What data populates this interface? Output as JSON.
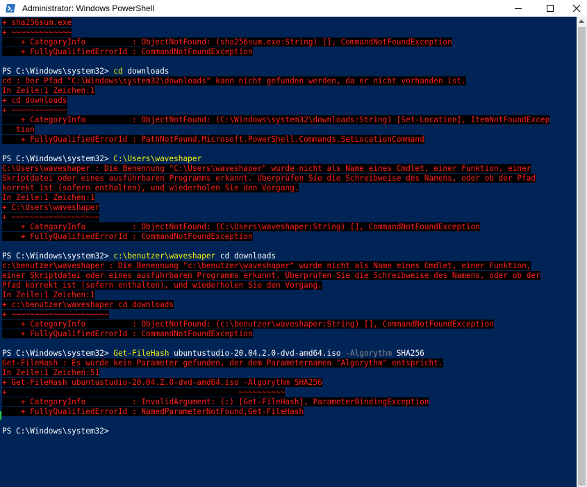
{
  "window": {
    "title": "Administrator: Windows PowerShell",
    "icon": "powershell-icon",
    "controls": {
      "minimize_icon": "minimize-icon",
      "maximize_icon": "maximize-icon",
      "close_icon": "close-icon"
    }
  },
  "colors": {
    "background": "#012456",
    "error_text": "#ff2020",
    "error_bg": "#000000",
    "command": "#f5f50a",
    "parameter": "#8a8a8a",
    "prompt": "#ffffff"
  },
  "console": {
    "lines": [
      [
        {
          "t": "err",
          "v": "+ sha256sum.exe"
        }
      ],
      [
        {
          "t": "err",
          "v": "+ ~~~~~~~~~~~~~"
        }
      ],
      [
        {
          "t": "err",
          "v": "    + CategoryInfo          : ObjectNotFound: (sha256sum.exe:String) [], CommandNotFoundException"
        }
      ],
      [
        {
          "t": "err",
          "v": "    + FullyQualifiedErrorId : CommandNotFoundException"
        }
      ],
      [],
      [
        {
          "t": "prompt",
          "v": "PS C:\\Windows\\system32> "
        },
        {
          "t": "cmd",
          "v": "cd"
        },
        {
          "t": "arg",
          "v": " downloads"
        }
      ],
      [
        {
          "t": "err",
          "v": "cd : Der Pfad \"C:\\Windows\\system32\\downloads\" kann nicht gefunden werden, da er nicht vorhanden ist."
        }
      ],
      [
        {
          "t": "err",
          "v": "In Zeile:1 Zeichen:1"
        }
      ],
      [
        {
          "t": "err",
          "v": "+ cd downloads"
        }
      ],
      [
        {
          "t": "err",
          "v": "+ ~~~~~~~~~~~~"
        }
      ],
      [
        {
          "t": "err",
          "v": "    + CategoryInfo          : ObjectNotFound: (C:\\Windows\\system32\\downloads:String) [Set-Location], ItemNotFoundExcep"
        }
      ],
      [
        {
          "t": "err",
          "v": "   tion"
        }
      ],
      [
        {
          "t": "err",
          "v": "    + FullyQualifiedErrorId : PathNotFound,Microsoft.PowerShell.Commands.SetLocationCommand"
        }
      ],
      [],
      [
        {
          "t": "prompt",
          "v": "PS C:\\Windows\\system32> "
        },
        {
          "t": "cmd",
          "v": "C:\\Users\\waveshaper"
        }
      ],
      [
        {
          "t": "err",
          "v": "C:\\Users\\waveshaper : Die Benennung \"C:\\Users\\waveshaper\" wurde nicht als Name eines Cmdlet, einer Funktion, einer"
        }
      ],
      [
        {
          "t": "err",
          "v": "Skriptdatei oder eines ausführbaren Programms erkannt. Überprüfen Sie die Schreibweise des Namens, oder ob der Pfad"
        }
      ],
      [
        {
          "t": "err",
          "v": "korrekt ist (sofern enthalten), und wiederholen Sie den Vorgang."
        }
      ],
      [
        {
          "t": "err",
          "v": "In Zeile:1 Zeichen:1"
        }
      ],
      [
        {
          "t": "err",
          "v": "+ C:\\Users\\waveshaper"
        }
      ],
      [
        {
          "t": "err",
          "v": "+ ~~~~~~~~~~~~~~~~~~~"
        }
      ],
      [
        {
          "t": "err",
          "v": "    + CategoryInfo          : ObjectNotFound: (C:\\Users\\waveshaper:String) [], CommandNotFoundException"
        }
      ],
      [
        {
          "t": "err",
          "v": "    + FullyQualifiedErrorId : CommandNotFoundException"
        }
      ],
      [],
      [
        {
          "t": "prompt",
          "v": "PS C:\\Windows\\system32> "
        },
        {
          "t": "cmd",
          "v": "c:\\benutzer\\waveshaper"
        },
        {
          "t": "arg",
          "v": " cd downloads"
        }
      ],
      [
        {
          "t": "err",
          "v": "c:\\benutzer\\waveshaper : Die Benennung \"c:\\benutzer\\waveshaper\" wurde nicht als Name eines Cmdlet, einer Funktion,"
        }
      ],
      [
        {
          "t": "err",
          "v": "einer Skriptdatei oder eines ausführbaren Programms erkannt. Überprüfen Sie die Schreibweise des Namens, oder ob der"
        }
      ],
      [
        {
          "t": "err",
          "v": "Pfad korrekt ist (sofern enthalten), und wiederholen Sie den Vorgang."
        }
      ],
      [
        {
          "t": "err",
          "v": "In Zeile:1 Zeichen:1"
        }
      ],
      [
        {
          "t": "err",
          "v": "+ c:\\benutzer\\waveshaper cd downloads"
        }
      ],
      [
        {
          "t": "err",
          "v": "+ ~~~~~~~~~~~~~~~~~~~~~"
        }
      ],
      [
        {
          "t": "err",
          "v": "    + CategoryInfo          : ObjectNotFound: (c:\\benutzer\\waveshaper:String) [], CommandNotFoundException"
        }
      ],
      [
        {
          "t": "err",
          "v": "    + FullyQualifiedErrorId : CommandNotFoundException"
        }
      ],
      [],
      [
        {
          "t": "prompt",
          "v": "PS C:\\Windows\\system32> "
        },
        {
          "t": "cmd",
          "v": "Get-FileHash"
        },
        {
          "t": "arg",
          "v": " ubuntustudio-20.04.2.0-dvd-amd64.iso "
        },
        {
          "t": "param",
          "v": "-Algorythm"
        },
        {
          "t": "arg",
          "v": " SHA256"
        }
      ],
      [
        {
          "t": "err",
          "v": "Get-FileHash : Es wurde kein Parameter gefunden, der dem Parameternamen \"Algorythm\" entspricht."
        }
      ],
      [
        {
          "t": "err",
          "v": "In Zeile:1 Zeichen:51"
        }
      ],
      [
        {
          "t": "err",
          "v": "+ Get-FileHash ubuntustudio-20.04.2.0-dvd-amd64.iso -Algorythm SHA256"
        }
      ],
      [
        {
          "t": "err",
          "v": "+                                                  ~~~~~~~~~~"
        }
      ],
      [
        {
          "t": "err",
          "v": "    + CategoryInfo          : InvalidArgument: (:) [Get-FileHash], ParameterBindingException"
        }
      ],
      [
        {
          "t": "err",
          "v": "    + FullyQualifiedErrorId : NamedParameterNotFound,Get-FileHash"
        }
      ],
      [],
      [
        {
          "t": "prompt",
          "v": "PS C:\\Windows\\system32> "
        }
      ]
    ]
  }
}
